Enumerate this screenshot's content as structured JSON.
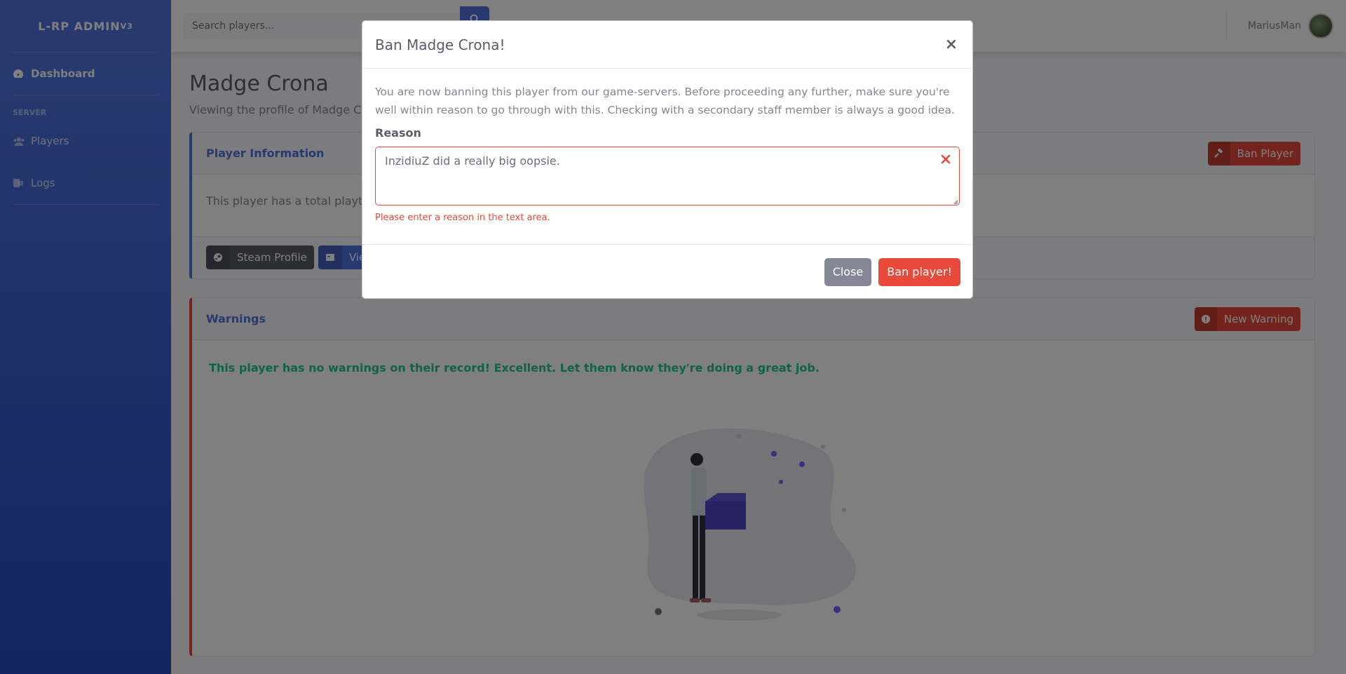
{
  "app": {
    "brand": "L-RP ADMIN",
    "brand_sup": "V3"
  },
  "sidebar": {
    "items": [
      {
        "label": "Dashboard",
        "icon": "tachometer-icon"
      },
      {
        "label": "Players",
        "icon": "users-icon"
      },
      {
        "label": "Logs",
        "icon": "file-icon"
      }
    ],
    "heading_server": "SERVER"
  },
  "topbar": {
    "search_placeholder": "Search players...",
    "username": "MariusMan"
  },
  "page": {
    "title": "Madge Crona",
    "subtitle": "Viewing the profile of Madge Cr"
  },
  "player_info": {
    "title": "Player Information",
    "ban_button": "Ban Player",
    "text": "This player has a total playtin",
    "steam_button": "Steam Profile",
    "view_button": "View"
  },
  "warnings": {
    "title": "Warnings",
    "new_button": "New Warning",
    "empty_message": "This player has no warnings on their record! Excellent. Let them know they're doing a great job."
  },
  "modal": {
    "title": "Ban Madge Crona!",
    "close_symbol": "×",
    "description": "You are now banning this player from our game-servers. Before proceeding any further, make sure you're well within reason to go through with this. Checking with a secondary staff member is always a good idea.",
    "reason_label": "Reason",
    "reason_value": "InzidiuZ did a really big oopsie.",
    "error_message": "Please enter a reason in the text area.",
    "close_button": "Close",
    "confirm_button": "Ban player!"
  },
  "colors": {
    "primary": "#4e73df",
    "danger": "#e74a3b",
    "success": "#1cc88a",
    "secondary": "#858796"
  }
}
